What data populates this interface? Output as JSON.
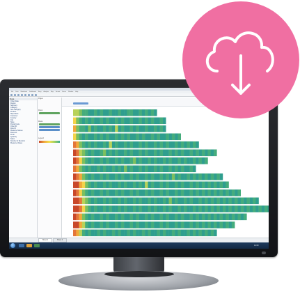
{
  "colors": {
    "badge": "#f06fa2",
    "badge_icon": "#ffffff",
    "heatmap_scale": [
      "#c9482a",
      "#e4763a",
      "#f0a83a",
      "#f3d34a",
      "#b8d25a",
      "#7cbf5f",
      "#45ac7c",
      "#2f9e8e"
    ]
  },
  "badge": {
    "icon": "cloud-download-icon"
  },
  "app": {
    "menu": [
      "File",
      "Data",
      "Worksheet",
      "Dashboard",
      "Story",
      "Analysis",
      "Map",
      "Format",
      "Server",
      "Window",
      "Help"
    ],
    "left_panel": {
      "header": "Data",
      "fields": [
        "Order Date",
        "Region",
        "Segment",
        "Category",
        "Sub-Category",
        "Product",
        "Ship Mode",
        "Customer",
        "Country",
        "City",
        "State",
        "Postal Code",
        "Order ID",
        "Row ID",
        "Measure Names",
        "Discount",
        "Profit",
        "Quantity",
        "Sales",
        "Number of Records",
        "Measure Values"
      ]
    },
    "cards": {
      "pages": "Pages",
      "filters": "Filters",
      "marks": "Marks",
      "legend": "Legend"
    },
    "sheet_tabs": [
      "Sheet 1",
      "Sheet 2"
    ],
    "clock": "12:00"
  },
  "chart_data": {
    "type": "heatmap",
    "rows": [
      {
        "cells": [
          4,
          4,
          5,
          6,
          6,
          7,
          7,
          6,
          7,
          6,
          7,
          7,
          6,
          7,
          7,
          6,
          7,
          7,
          6,
          6,
          7,
          7,
          6,
          7,
          6,
          7,
          6,
          7
        ]
      },
      {
        "cells": [
          3,
          5,
          6,
          7,
          6,
          7,
          6,
          7,
          7,
          6,
          7,
          6,
          7,
          7,
          6,
          7,
          6,
          7,
          7,
          6,
          7,
          7,
          6,
          7,
          6,
          7,
          6,
          7,
          7,
          6,
          7
        ]
      },
      {
        "cells": [
          2,
          5,
          6,
          6,
          7,
          5,
          7,
          6,
          7,
          7,
          6,
          7,
          6,
          7,
          4,
          7,
          6,
          7,
          7,
          6,
          7,
          6,
          7,
          7,
          6,
          7,
          7,
          6,
          7,
          6,
          7
        ]
      },
      {
        "cells": [
          3,
          5,
          6,
          7,
          6,
          7,
          7,
          6,
          7,
          6,
          7,
          6,
          7,
          7,
          6,
          7,
          6,
          7,
          6,
          7,
          7,
          6,
          7,
          6,
          7,
          7,
          6,
          7,
          6,
          7,
          7,
          6,
          7,
          6,
          7,
          6
        ]
      },
      {
        "cells": [
          1,
          2,
          5,
          6,
          7,
          6,
          7,
          6,
          7,
          7,
          6,
          7,
          4,
          7,
          6,
          7,
          7,
          6,
          7,
          6,
          7,
          7,
          6,
          7,
          6,
          7,
          7,
          6,
          7,
          6,
          7,
          6,
          7,
          7,
          6,
          7,
          6,
          7,
          6,
          7,
          6,
          7
        ]
      },
      {
        "cells": [
          0,
          1,
          4,
          5,
          6,
          7,
          6,
          7,
          7,
          6,
          5,
          7,
          6,
          7,
          6,
          7,
          7,
          6,
          7,
          6,
          7,
          7,
          6,
          7,
          6,
          7,
          7,
          6,
          7,
          6,
          7,
          7,
          6,
          7,
          6,
          7,
          6,
          7,
          7,
          6,
          7,
          6,
          7,
          6,
          7,
          6,
          7,
          6
        ]
      },
      {
        "cells": [
          0,
          1,
          3,
          5,
          6,
          7,
          6,
          7,
          7,
          6,
          7,
          6,
          7,
          7,
          6,
          7,
          6,
          7,
          7,
          6,
          5,
          7,
          6,
          7,
          7,
          6,
          7,
          6,
          7,
          7,
          6,
          7,
          6,
          7,
          7,
          6,
          7,
          6,
          7,
          7,
          6,
          7,
          6,
          7,
          6
        ]
      },
      {
        "cells": [
          1,
          2,
          5,
          6,
          7,
          6,
          7,
          7,
          6,
          7,
          6,
          7,
          7,
          6,
          7,
          6,
          7,
          5,
          7,
          6,
          7,
          7,
          6,
          7,
          6,
          7,
          7,
          6,
          7,
          6,
          7,
          7,
          6,
          7,
          6,
          7,
          6,
          7,
          7,
          6,
          7
        ]
      },
      {
        "cells": [
          0,
          1,
          2,
          5,
          6,
          7,
          6,
          7,
          7,
          6,
          7,
          6,
          7,
          7,
          6,
          7,
          6,
          7,
          7,
          6,
          7,
          6,
          7,
          7,
          6,
          7,
          6,
          7,
          7,
          6,
          7,
          6,
          7,
          5,
          7,
          6,
          7,
          7,
          6,
          7,
          6,
          7,
          6,
          7,
          6,
          7,
          6,
          7,
          6,
          7
        ]
      },
      {
        "cells": [
          0,
          0,
          2,
          3,
          5,
          6,
          7,
          6,
          7,
          7,
          6,
          7,
          6,
          7,
          7,
          6,
          7,
          6,
          7,
          7,
          6,
          7,
          6,
          7,
          4,
          7,
          6,
          7,
          7,
          6,
          7,
          6,
          7,
          7,
          6,
          7,
          6,
          7,
          7,
          6,
          7,
          6,
          7,
          6,
          7,
          6,
          7,
          6,
          7,
          6,
          7,
          6
        ]
      },
      {
        "cells": [
          0,
          1,
          3,
          5,
          6,
          7,
          6,
          7,
          7,
          6,
          7,
          6,
          7,
          7,
          6,
          7,
          6,
          7,
          7,
          6,
          7,
          6,
          7,
          7,
          6,
          7,
          6,
          7,
          7,
          6,
          7,
          6,
          7,
          7,
          6,
          7,
          6,
          7,
          7,
          6,
          7,
          6,
          7,
          6,
          7,
          6,
          7,
          6,
          7,
          6,
          7,
          6,
          7,
          6,
          7,
          6
        ]
      },
      {
        "cells": [
          0,
          0,
          1,
          4,
          5,
          6,
          7,
          6,
          7,
          7,
          6,
          7,
          6,
          7,
          7,
          6,
          7,
          6,
          7,
          7,
          6,
          7,
          6,
          7,
          7,
          6,
          7,
          6,
          7,
          7,
          6,
          7,
          5,
          7,
          6,
          7,
          7,
          6,
          7,
          6,
          7,
          7,
          6,
          7,
          6,
          7,
          6,
          7,
          6,
          7,
          6,
          7,
          6,
          7,
          6,
          7,
          6,
          7,
          6,
          7,
          6,
          7
        ]
      },
      {
        "cells": [
          0,
          0,
          1,
          3,
          5,
          6,
          7,
          6,
          7,
          7,
          6,
          7,
          6,
          7,
          7,
          6,
          7,
          6,
          7,
          7,
          6,
          7,
          6,
          7,
          7,
          6,
          7,
          6,
          7,
          7,
          6,
          7,
          6,
          7,
          7,
          6,
          7,
          6,
          7,
          7,
          6,
          7,
          6,
          7,
          6,
          7,
          6,
          7,
          6,
          7,
          6,
          7,
          6,
          7,
          6,
          7,
          6,
          7,
          6,
          7,
          6,
          7,
          6,
          7,
          6,
          7,
          6,
          7
        ]
      },
      {
        "cells": [
          0,
          1,
          2,
          5,
          6,
          7,
          6,
          7,
          7,
          6,
          7,
          6,
          7,
          7,
          6,
          7,
          6,
          7,
          7,
          6,
          7,
          6,
          7,
          7,
          6,
          7,
          6,
          7,
          7,
          6,
          7,
          6,
          7,
          7,
          6,
          7,
          6,
          7,
          7,
          6,
          7,
          6,
          7,
          6,
          7,
          6,
          7,
          6,
          7,
          6,
          7,
          6,
          7,
          6,
          7,
          6,
          7,
          6
        ]
      },
      {
        "cells": [
          0,
          0,
          2,
          4,
          6,
          7,
          6,
          7,
          7,
          6,
          7,
          6,
          7,
          7,
          6,
          7,
          6,
          7,
          7,
          6,
          7,
          6,
          7,
          7,
          6,
          7,
          6,
          7,
          7,
          6,
          7,
          6,
          7,
          7,
          6,
          7,
          6,
          7,
          7,
          6,
          7,
          6,
          7,
          6,
          7,
          6,
          7,
          6,
          7,
          6,
          7,
          6,
          7,
          6
        ]
      },
      {
        "cells": [
          1,
          2,
          4,
          6,
          7,
          6,
          7,
          7,
          6,
          7,
          6,
          7,
          7,
          6,
          7,
          6,
          7,
          7,
          6,
          7,
          6,
          7,
          7,
          6,
          7,
          6,
          7,
          7,
          6,
          7,
          6,
          7,
          7,
          6,
          7,
          6,
          7,
          7,
          6,
          7,
          6,
          7,
          6,
          7,
          6,
          7,
          6,
          7
        ]
      }
    ]
  }
}
